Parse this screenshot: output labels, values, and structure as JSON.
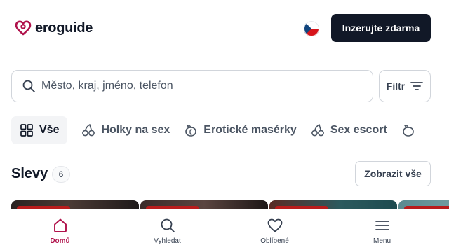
{
  "header": {
    "brand": "eroguide",
    "cta_label": "Inzerujte zdarma"
  },
  "search": {
    "placeholder": "Město, kraj, jméno, telefon",
    "filter_label": "Filtr"
  },
  "categories": [
    {
      "label": "Vše",
      "icon": "grid-icon",
      "active": true
    },
    {
      "label": "Holky na sex",
      "icon": "cherries-icon",
      "active": false
    },
    {
      "label": "Erotické masérky",
      "icon": "peach-icon",
      "active": false
    },
    {
      "label": "Sex escort",
      "icon": "cherries-icon",
      "active": false
    }
  ],
  "section": {
    "title": "Slevy",
    "count": "6",
    "show_all_label": "Zobrazit vše"
  },
  "bottom_nav": [
    {
      "label": "Domů",
      "icon": "home-icon",
      "active": true
    },
    {
      "label": "Vyhledat",
      "icon": "search-icon",
      "active": false
    },
    {
      "label": "Oblíbené",
      "icon": "heart-icon",
      "active": false
    },
    {
      "label": "Menu",
      "icon": "menu-icon",
      "active": false
    }
  ],
  "colors": {
    "brand": "#b0124b",
    "cta_bg": "#111827",
    "discount_tag": "#b91c1c"
  }
}
